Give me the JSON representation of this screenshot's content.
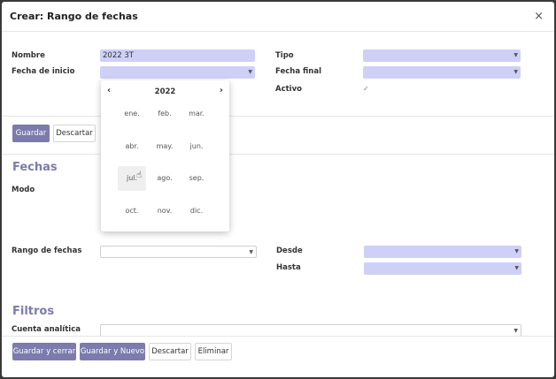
{
  "dialog": {
    "title": "Crear: Rango de fechas",
    "close_icon": "×"
  },
  "form": {
    "nombre_label": "Nombre",
    "nombre_value": "2022 3T",
    "fecha_inicio_label": "Fecha de inicio",
    "tipo_label": "Tipo",
    "fecha_final_label": "Fecha final",
    "activo_label": "Activo",
    "activo_check": "✓"
  },
  "top_buttons": {
    "guardar": "Guardar",
    "descartar": "Descartar"
  },
  "fechas": {
    "title": "Fechas",
    "modo_label": "Modo",
    "rango_label": "Rango de fechas",
    "desde_label": "Desde",
    "hasta_label": "Hasta"
  },
  "filtros": {
    "title": "Filtros",
    "cuenta_label": "Cuenta analítica"
  },
  "footer_buttons": {
    "guardar_cerrar": "Guardar y cerrar",
    "guardar_nuevo": "Guardar y Nuevo",
    "descartar": "Descartar",
    "eliminar": "Eliminar"
  },
  "datepicker": {
    "year": "2022",
    "prev": "‹",
    "next": "›",
    "months": [
      "ene.",
      "feb.",
      "mar.",
      "abr.",
      "may.",
      "jun.",
      "jul.",
      "ago.",
      "sep.",
      "oct.",
      "nov.",
      "dic."
    ],
    "hovered_month": "jul."
  },
  "colors": {
    "accent": "#7c7bad",
    "field_bg": "#cfd0f7"
  },
  "icons": {
    "caret": "caret-down-icon",
    "cursor": "hand-pointer-icon"
  }
}
